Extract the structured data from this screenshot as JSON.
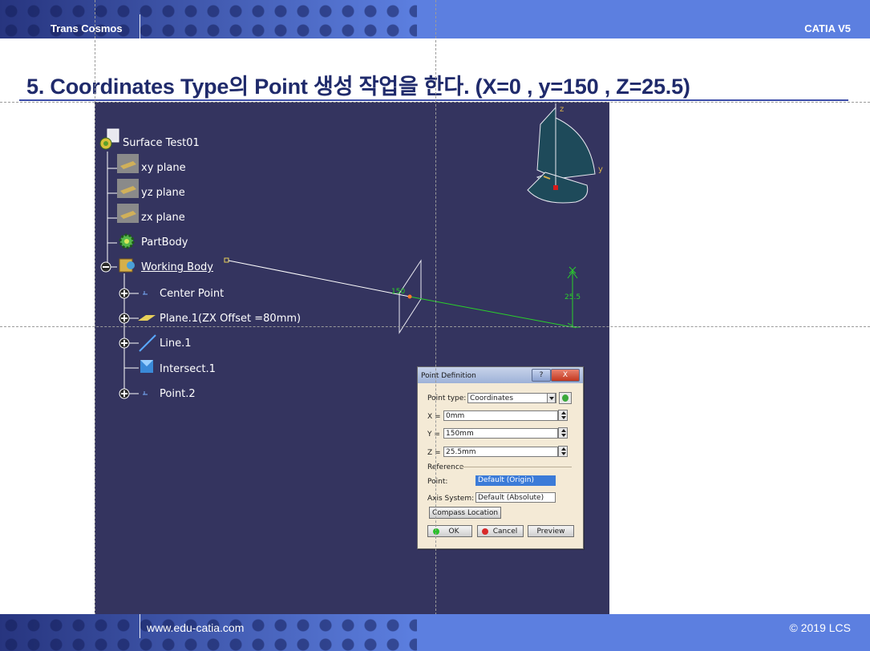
{
  "header": {
    "brand": "Trans Cosmos",
    "product": "CATIA V5"
  },
  "footer": {
    "url": "www.edu-catia.com",
    "copyright": "© 2019 LCS"
  },
  "title": "5. Coordinates Type의 Point 생성 작업을 한다. (X=0 , y=150 , Z=25.5)",
  "tree": {
    "root": "Surface Test01",
    "items": [
      {
        "label": "xy plane",
        "icon": "plane-icon"
      },
      {
        "label": "yz plane",
        "icon": "plane-icon"
      },
      {
        "label": "zx plane",
        "icon": "plane-icon"
      },
      {
        "label": "PartBody",
        "icon": "gear-icon"
      },
      {
        "label": "Working Body",
        "icon": "body-icon"
      },
      {
        "label": "Center Point",
        "icon": "point-icon"
      },
      {
        "label": "Plane.1(ZX Offset =80mm)",
        "icon": "plane-icon"
      },
      {
        "label": "Line.1",
        "icon": "line-icon"
      },
      {
        "label": "Intersect.1",
        "icon": "intersect-icon"
      },
      {
        "label": "Point.2",
        "icon": "point-icon"
      }
    ]
  },
  "viewport": {
    "compass_axes": [
      "z",
      "y"
    ],
    "dim_150": "150",
    "dim_255": "25.5",
    "colors": {
      "background": "#34345f",
      "accent": "#2ad02a"
    }
  },
  "dialog": {
    "title": "Point Definition",
    "help_label": "?",
    "close_label": "X",
    "point_type_label": "Point type:",
    "point_type_value": "Coordinates",
    "x_label": "X =",
    "x_value": "0mm",
    "y_label": "Y =",
    "y_value": "150mm",
    "z_label": "Z =",
    "z_value": "25.5mm",
    "reference_label": "Reference",
    "point_label": "Point:",
    "point_value": "Default (Origin)",
    "axis_label": "Axis System:",
    "axis_value": "Default (Absolute)",
    "compass_button": "Compass Location",
    "ok_button": "OK",
    "cancel_button": "Cancel",
    "preview_button": "Preview"
  }
}
